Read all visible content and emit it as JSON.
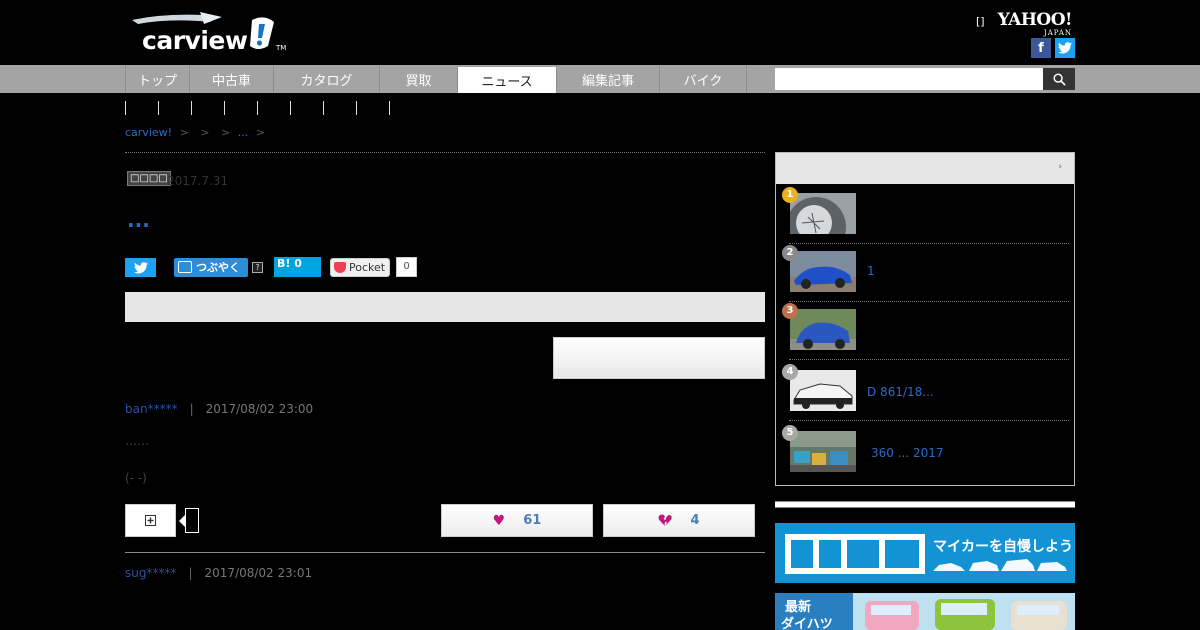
{
  "header": {
    "logo_text": "carview",
    "logo_tm": "TM",
    "bracket": "[]",
    "yahoo": "YAHOO!",
    "yahoo_sub": "JAPAN",
    "facebook_glyph": "f"
  },
  "nav": {
    "tabs": [
      {
        "label": "トップ"
      },
      {
        "label": "中古車"
      },
      {
        "label": "カタログ"
      },
      {
        "label": "買取"
      },
      {
        "label": "ニュース"
      },
      {
        "label": "編集記事"
      },
      {
        "label": "バイク"
      }
    ],
    "active_tab": "ニュース",
    "search_placeholder": ""
  },
  "breadcrumb": {
    "home": "carview!",
    "sep": ">",
    "current": "..."
  },
  "article": {
    "category": "□□□□",
    "date": "2017.7.31",
    "title": "...",
    "tweet_label": "つぶやく",
    "tweet_help": "?",
    "hatena_label": "B!",
    "hatena_count": "0",
    "pocket_label": "Pocket",
    "pocket_count": "0"
  },
  "comments": [
    {
      "user": "ban*****",
      "sep": "|",
      "date": "2017/08/02 23:00",
      "line1": "……",
      "line2": "(- -)",
      "good": "61",
      "bad": "4"
    },
    {
      "user": "sug*****",
      "sep": "|",
      "date": "2017/08/02 23:01"
    }
  ],
  "sidebar": {
    "more_icon": "›",
    "ranking": [
      {
        "rank": "1",
        "title": "",
        "badge_color": "#e8b21e"
      },
      {
        "rank": "2",
        "title": "1",
        "badge_color": "#8a8a8a"
      },
      {
        "rank": "3",
        "title": "",
        "badge_color": "#c0704a"
      },
      {
        "rank": "4",
        "title": "D 861/18...",
        "badge_color": "#a8a8a8"
      },
      {
        "rank": "5",
        "title": "360 ... 2017",
        "badge_color": "#a8a8a8"
      }
    ],
    "banner1_text": "マイカーを自慢しよう!",
    "banner2_text1": "最新",
    "banner2_text2": "ダイハツ"
  },
  "colors": {
    "link": "#2a6ac8",
    "nav_bg": "#a4a4a4",
    "twitter": "#1da1f2",
    "facebook": "#3b5998",
    "heart": "#c2177a"
  }
}
